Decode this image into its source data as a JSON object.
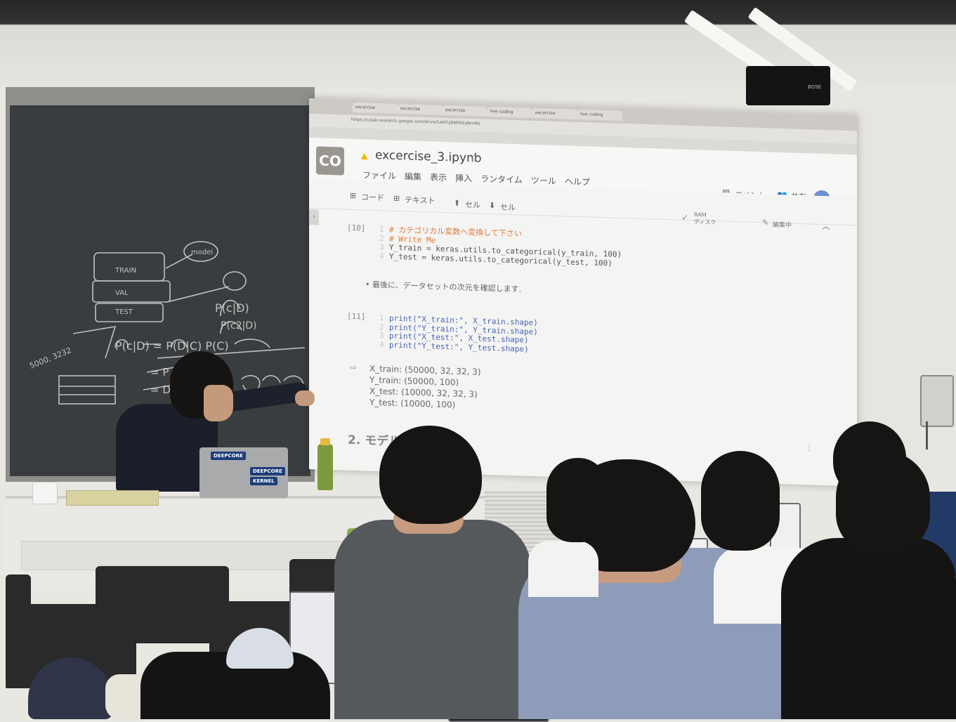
{
  "browser": {
    "url": "https://colab.research.google.com/drive/1eKFLJ6NF6XqNmRb",
    "tabs": [
      "excercise",
      "excercise",
      "excercise",
      "live coding",
      "excercise",
      "live coding"
    ]
  },
  "colab": {
    "logo": "CO",
    "notebook_title": "excercise_3.ipynb",
    "menu": [
      "ファイル",
      "編集",
      "表示",
      "挿入",
      "ランタイム",
      "ツール",
      "ヘルプ"
    ],
    "comment_label": "コメント",
    "share_label": "共有",
    "toolbar": {
      "add_code": "コード",
      "add_text": "テキスト",
      "cell_up": "セル",
      "cell_down": "セル",
      "ram_label": "RAM",
      "disk_label": "ディスク",
      "edit_status": "編集中"
    },
    "cells": [
      {
        "number": "[10]",
        "lines": [
          "# カテゴリカル変数へ変換して下さい",
          "# Write Me",
          "Y_train = keras.utils.to_categorical(y_train, 100)",
          "Y_test = keras.utils.to_categorical(y_test, 100)"
        ]
      },
      {
        "markdown": "最後に、データセットの次元を確認します."
      },
      {
        "number": "[11]",
        "lines": [
          "print(\"X_train:\", X_train.shape)",
          "print(\"Y_train:\", Y_train.shape)",
          "print(\"X_test:\", X_test.shape)",
          "print(\"Y_test:\", Y_test.shape)"
        ],
        "output": [
          "X_train: (50000, 32, 32, 3)",
          "Y_train: (50000, 100)",
          "X_test: (10000, 32, 32, 3)",
          "Y_test: (10000, 100)"
        ]
      }
    ],
    "section_heading": "2. モデル"
  },
  "scene": {
    "sticker_labels": [
      "DEEPCORE",
      "DEEPCORE",
      "KERNEL"
    ],
    "speaker_brand": "BOSE",
    "colors": {
      "board": "#3a3d3f",
      "screen": "#f4f4f2",
      "comment_orange": "#e07a3a",
      "code_blue": "#4a62b8"
    }
  }
}
